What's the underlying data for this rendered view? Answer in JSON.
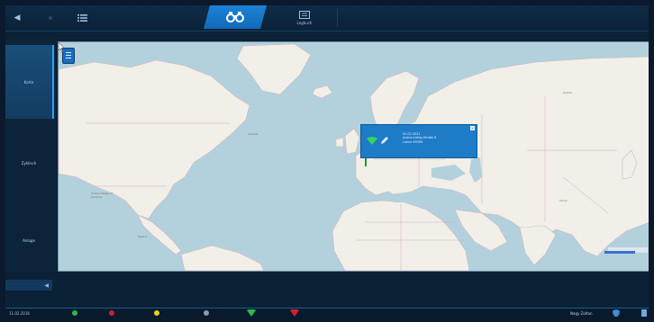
{
  "header": {
    "back_icon": "back-arrow-icon",
    "tabs": [
      {
        "icon": "binoculars-icon",
        "label": "",
        "active": true
      },
      {
        "icon": "logbook-icon",
        "label": "Logbuch",
        "active": false
      }
    ]
  },
  "sidebar": {
    "items": [
      {
        "label": "Karte",
        "active": true
      },
      {
        "label": "Zyklisch",
        "active": false
      },
      {
        "label": "Anlage",
        "active": false
      }
    ],
    "collapse_icon": "chevron-left-icon"
  },
  "map": {
    "country_labels": [
      "Canada",
      "Russia",
      "United States of America",
      "China",
      "Mexico"
    ],
    "popup": {
      "line1": "02.02.2021",
      "line2": "Justus-Liebig-Straße 6",
      "line3": "Lohne 49393"
    }
  },
  "statusbar": {
    "date": "11.02.2016",
    "user": "Nagy Zoltan",
    "indicator_colors": [
      "#2db84a",
      "#d0202a",
      "#e6d21a",
      "#8f9aa6"
    ]
  },
  "colors": {
    "accent": "#1e7bc6",
    "map_water": "#b3d1dc",
    "map_land": "#f2efe9"
  }
}
